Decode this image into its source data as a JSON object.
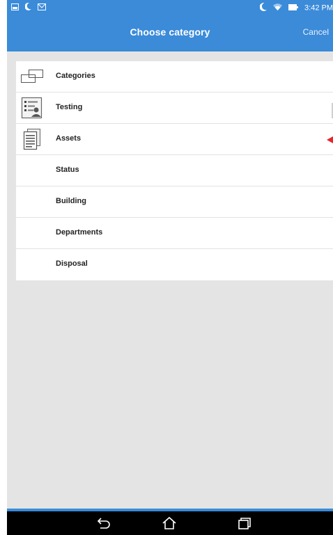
{
  "status_bar": {
    "time": "3:42 PM",
    "left_icons": [
      "image-notification-icon",
      "moon-icon",
      "mail-icon"
    ],
    "right_icons": [
      "moon-icon",
      "wifi-icon",
      "battery-icon"
    ]
  },
  "action_bar": {
    "title": "Choose category",
    "cancel_label": "Cancel"
  },
  "categories": [
    {
      "label": "Categories",
      "icon": "categories-icon"
    },
    {
      "label": "Testing",
      "icon": "testing-icon"
    },
    {
      "label": "Assets",
      "icon": "assets-icon"
    },
    {
      "label": "Status",
      "icon": ""
    },
    {
      "label": "Building",
      "icon": ""
    },
    {
      "label": "Departments",
      "icon": ""
    },
    {
      "label": "Disposal",
      "icon": ""
    }
  ],
  "nav_bar": {
    "buttons": [
      "back-icon",
      "home-icon",
      "recent-apps-icon"
    ]
  },
  "colors": {
    "primary": "#3b8bd9",
    "background": "#e4e4e4",
    "marker": "#e8242a"
  }
}
